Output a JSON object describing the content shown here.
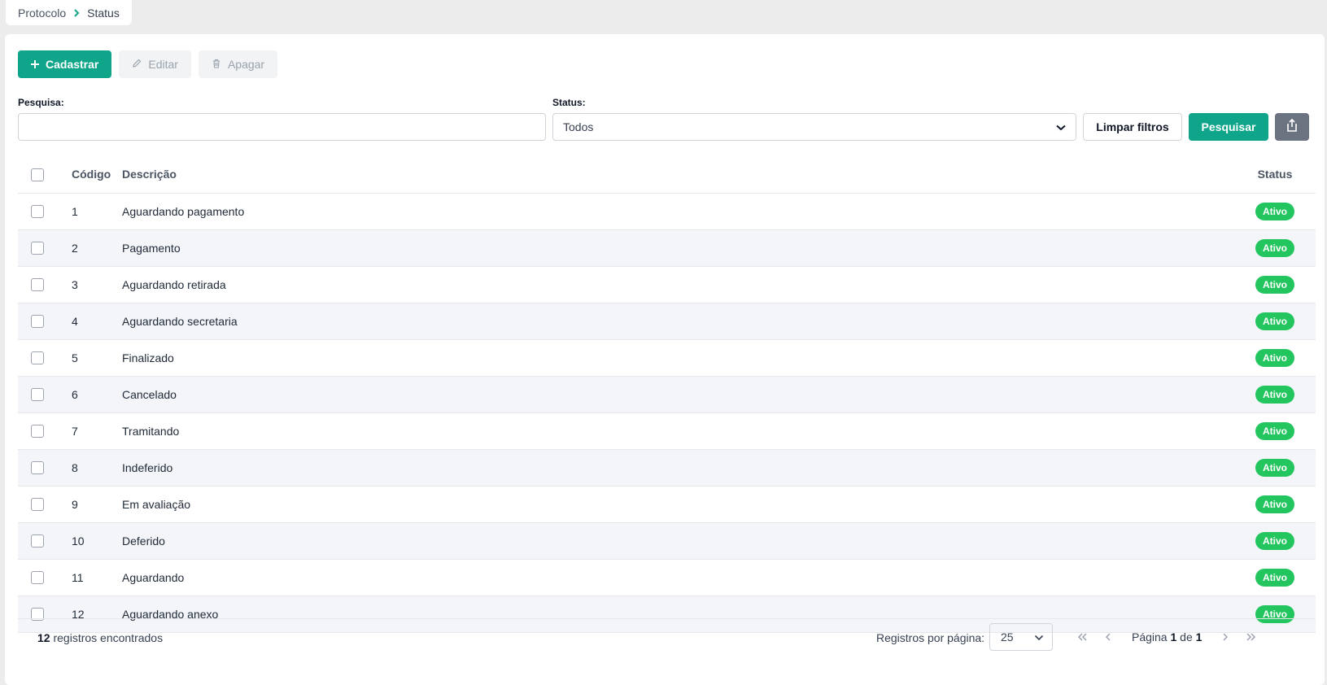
{
  "breadcrumb": {
    "parent": "Protocolo",
    "current": "Status"
  },
  "toolbar": {
    "create_label": "Cadastrar",
    "edit_label": "Editar",
    "delete_label": "Apagar"
  },
  "filters": {
    "search_label": "Pesquisa:",
    "search_value": "",
    "status_label": "Status:",
    "status_value": "Todos",
    "clear_label": "Limpar filtros",
    "search_button": "Pesquisar"
  },
  "table": {
    "headers": {
      "code": "Código",
      "description": "Descrição",
      "status": "Status"
    },
    "rows": [
      {
        "code": "1",
        "description": "Aguardando pagamento",
        "status": "Ativo"
      },
      {
        "code": "2",
        "description": "Pagamento",
        "status": "Ativo"
      },
      {
        "code": "3",
        "description": "Aguardando retirada",
        "status": "Ativo"
      },
      {
        "code": "4",
        "description": "Aguardando secretaria",
        "status": "Ativo"
      },
      {
        "code": "5",
        "description": "Finalizado",
        "status": "Ativo"
      },
      {
        "code": "6",
        "description": "Cancelado",
        "status": "Ativo"
      },
      {
        "code": "7",
        "description": "Tramitando",
        "status": "Ativo"
      },
      {
        "code": "8",
        "description": "Indeferido",
        "status": "Ativo"
      },
      {
        "code": "9",
        "description": "Em avaliação",
        "status": "Ativo"
      },
      {
        "code": "10",
        "description": "Deferido",
        "status": "Ativo"
      },
      {
        "code": "11",
        "description": "Aguardando",
        "status": "Ativo"
      },
      {
        "code": "12",
        "description": "Aguardando anexo",
        "status": "Ativo"
      }
    ]
  },
  "footer": {
    "count": "12",
    "count_suffix": " registros encontrados",
    "per_page_label": "Registros por página:",
    "per_page_value": "25",
    "page_prefix": "Página ",
    "page_current": "1",
    "page_of": " de ",
    "page_total": "1"
  },
  "colors": {
    "accent": "#0ea58b",
    "badge": "#22c55e",
    "export_button": "#6b7280"
  },
  "icons": [
    "chevron-right-icon",
    "plus-icon",
    "pencil-icon",
    "trash-icon",
    "chevron-down-icon",
    "export-icon",
    "first-page-icon",
    "prev-page-icon",
    "next-page-icon",
    "last-page-icon"
  ]
}
